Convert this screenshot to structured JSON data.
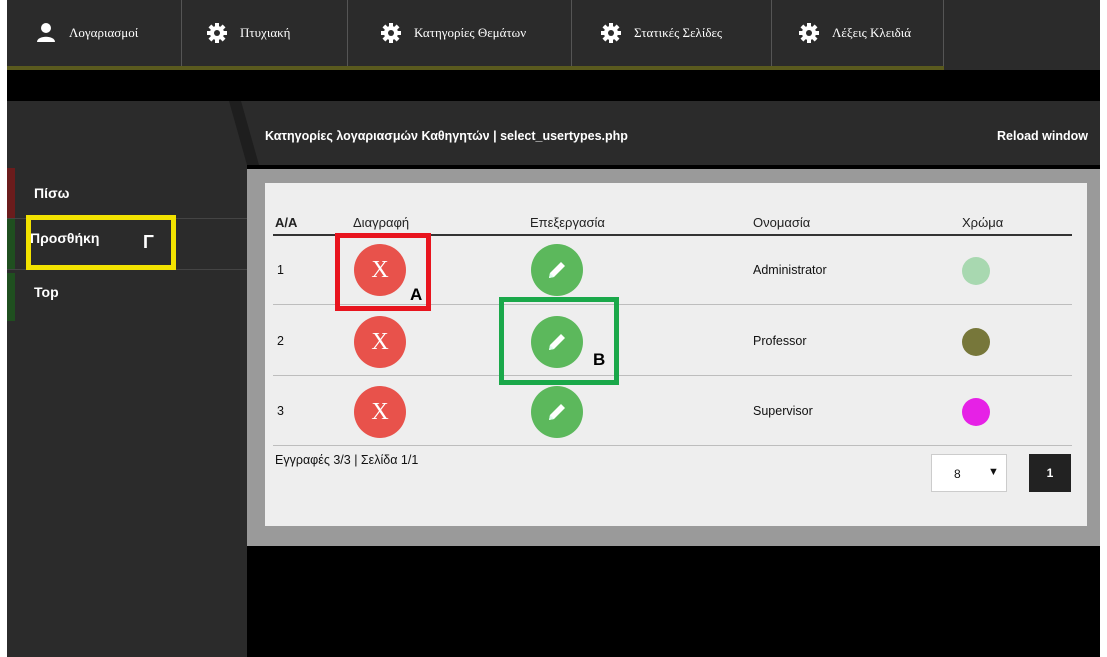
{
  "nav": {
    "items": [
      {
        "label": "Λογαριασμοί",
        "icon": "user-icon"
      },
      {
        "label": "Πτυχιακή",
        "icon": "gear-icon"
      },
      {
        "label": "Κατηγορίες Θεμάτων",
        "icon": "gear-icon"
      },
      {
        "label": "Στατικές Σελίδες",
        "icon": "gear-icon"
      },
      {
        "label": "Λέξεις Κλειδιά",
        "icon": "gear-icon"
      }
    ]
  },
  "sidebar": {
    "items": [
      {
        "label": "Πίσω"
      },
      {
        "label": "Προσθήκη"
      },
      {
        "label": "Top"
      }
    ]
  },
  "header": {
    "title": "Κατηγορίες λογαριασμών Καθηγητών | select_usertypes.php",
    "reload_label": "Reload window"
  },
  "table": {
    "columns": [
      "A/A",
      "Διαγραφή",
      "Επεξεργασία",
      "Ονομασία",
      "Χρώμα"
    ],
    "delete_label": "X",
    "rows": [
      {
        "aa": "1",
        "name": "Administrator",
        "color": "#a8d8b0"
      },
      {
        "aa": "2",
        "name": "Professor",
        "color": "#77773a"
      },
      {
        "aa": "3",
        "name": "Supervisor",
        "color": "#e621e6"
      }
    ]
  },
  "footer": {
    "info": "Εγγραφές 3/3 | Σελίδα 1/1",
    "per_page": "8",
    "caret": "▼",
    "page": "1"
  },
  "annotations": {
    "a": "A",
    "b": "B",
    "g": "Γ"
  },
  "colors": {
    "delete": "#e8524b",
    "edit": "#5cb85c",
    "annotation_red": "#e8141e",
    "annotation_green": "#1aa84a",
    "annotation_yellow": "#f2e200"
  }
}
